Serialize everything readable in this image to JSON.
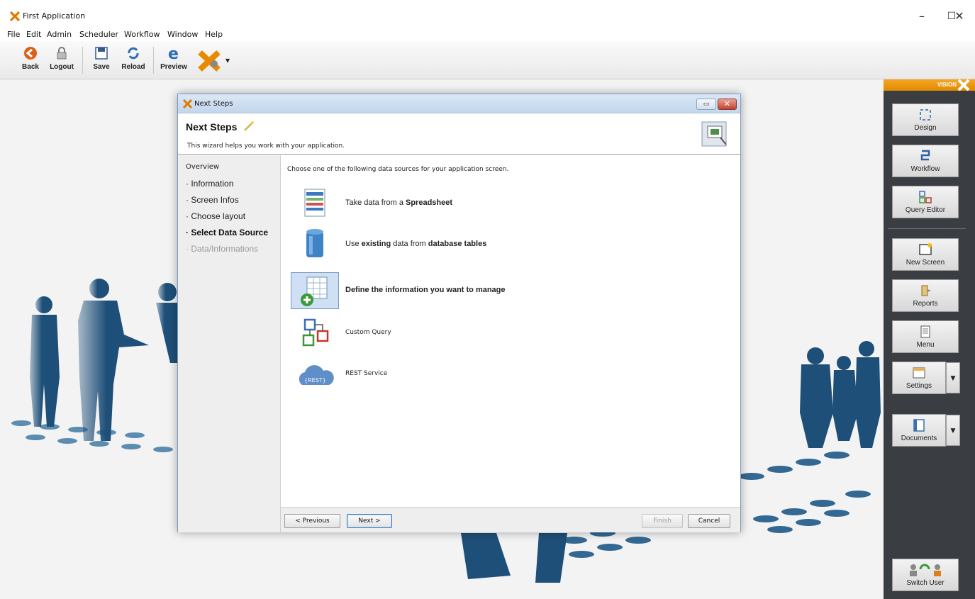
{
  "window": {
    "title": "First Application",
    "min": "–",
    "max": "☐",
    "close": "✕"
  },
  "menu": [
    "File",
    "Edit",
    "Admin",
    "Scheduler",
    "Workflow",
    "Window",
    "Help"
  ],
  "toolbar": {
    "back": "Back",
    "logout": "Logout",
    "save": "Save",
    "reload": "Reload",
    "preview": "Preview",
    "dropdown": "▾"
  },
  "right_panel": {
    "brand": "VISION",
    "buttons": {
      "design": "Design",
      "workflow": "Workflow",
      "query_editor": "Query Editor",
      "new_screen": "New Screen",
      "reports": "Reports",
      "menu": "Menu",
      "settings": "Settings",
      "documents": "Documents",
      "switch_user": "Switch User"
    }
  },
  "dialog": {
    "window_title": "Next Steps",
    "header_title": "Next Steps",
    "header_subtitle": "This wizard helps you work with your application.",
    "overview": "Overview",
    "steps": [
      "Information",
      "Screen Infos",
      "Choose layout",
      "Select Data Source",
      "Data/Informations"
    ],
    "active_step": "Select Data Source",
    "instruction": "Choose one of the following data sources for your application screen.",
    "options": {
      "spreadsheet": {
        "pre": "Take data from a ",
        "bold": "Spreadsheet"
      },
      "database": {
        "pre": "Use ",
        "bold1": "existing",
        "mid": " data from ",
        "bold2": "database tables"
      },
      "define": "Define the information you want to manage",
      "custom_query": "Custom Query",
      "rest": "REST Service",
      "rest_icon_text": "{REST}"
    },
    "buttons": {
      "previous": "< Previous",
      "next": "Next >",
      "finish": "Finish",
      "cancel": "Cancel"
    }
  },
  "colors": {
    "accent": "#f5a623",
    "silhouette": "#1e4f78",
    "panel": "#3a3d42"
  }
}
